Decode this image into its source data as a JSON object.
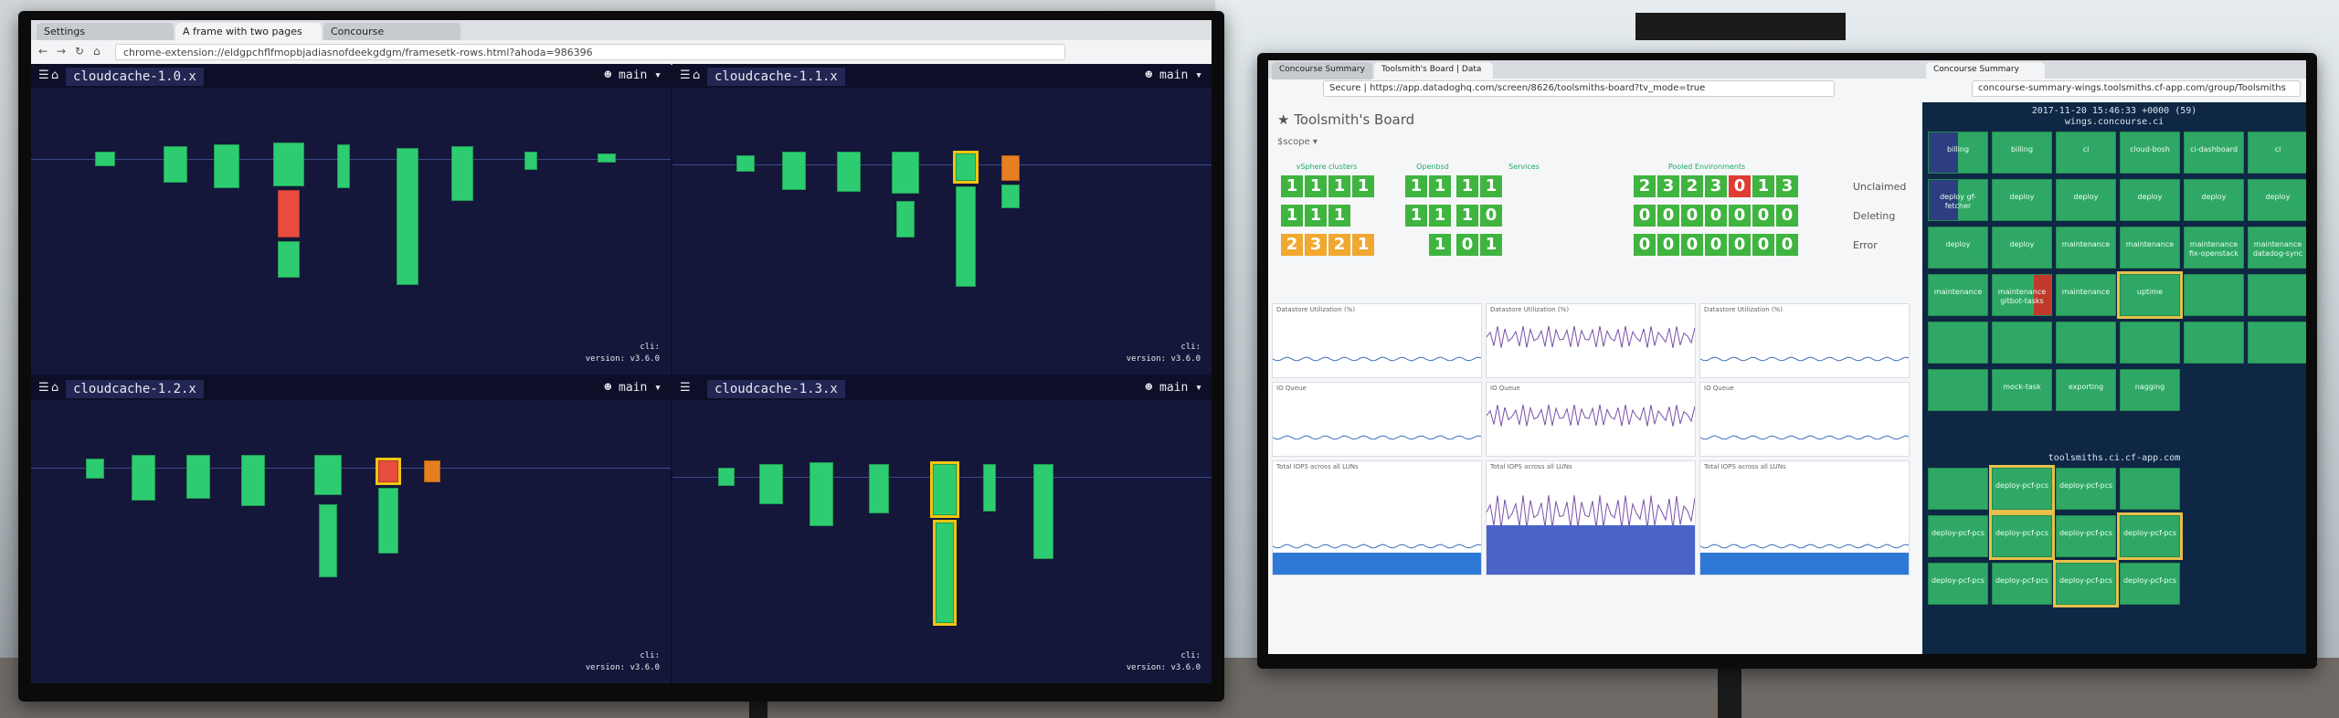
{
  "left_monitor": {
    "tabs": [
      "Settings",
      "A frame with two pages",
      "Concourse"
    ],
    "url": "chrome-extension://eldgpchflfmopbjadiasnofdeekgdgm/framesetk-rows.html?ahoda=986396",
    "quadrants": [
      {
        "name": "cloudcache-1.0.x",
        "branch": "main",
        "cli": "cli:",
        "version": "version: v3.6.0"
      },
      {
        "name": "cloudcache-1.1.x",
        "branch": "main",
        "cli": "cli:",
        "version": "version: v3.6.0"
      },
      {
        "name": "cloudcache-1.2.x",
        "branch": "main",
        "cli": "cli:",
        "version": "version: v3.6.0"
      },
      {
        "name": "cloudcache-1.3.x",
        "branch": "main",
        "cli": "cli:",
        "version": "version: v3.6.0"
      }
    ]
  },
  "right_monitor": {
    "tabs": [
      "Concourse Summary",
      "Toolsmith's Board | Data",
      "Concourse Summary"
    ],
    "url_left": "Secure | https://app.datadoghq.com/screen/8626/toolsmiths-board?tv_mode=true",
    "url_right": "concourse-summary-wings.toolsmiths.cf-app.com/group/Toolsmiths",
    "board_title": "Toolsmith's Board",
    "scope_label": "$scope",
    "sections": [
      "vSphere clusters",
      "Openbsd",
      "Services",
      "Pooled Environments"
    ],
    "row_labels": [
      "Unclaimed",
      "Deleting",
      "Error"
    ],
    "grid_rows": [
      [
        "1",
        "1",
        "1",
        "1",
        "",
        "1",
        "1",
        "1",
        "1",
        "2",
        "3",
        "2",
        "3",
        "0",
        "1",
        "3"
      ],
      [
        "1",
        "1",
        "1",
        "",
        "",
        "1",
        "1",
        "1",
        "0",
        "0",
        "0",
        "0",
        "0",
        "0",
        "0",
        "0"
      ],
      [
        "2",
        "3",
        "2",
        "1",
        "",
        "",
        "1",
        "0",
        "1",
        "0",
        "0",
        "0",
        "0",
        "0",
        "0",
        "0"
      ]
    ],
    "graph_titles": [
      "Datastore Utilization (%)",
      "Datastore Utilization (%)",
      "Datastore Utilization (%)",
      "IO Queue",
      "IO Queue",
      "IO Queue",
      "Total IOPS across all LUNs",
      "Total IOPS across all LUNs",
      "Total IOPS across all LUNs"
    ],
    "summary_time": "2017-11-20 15:46:33 +0000 (59)",
    "group1_host": "wings.concourse.ci",
    "group1_tiles": [
      "billing",
      "billing",
      "ci",
      "cloud-bosh",
      "ci-dashboard",
      "ci",
      "deploy gf-fetcher",
      "deploy",
      "deploy",
      "deploy",
      "deploy",
      "deploy",
      "deploy",
      "deploy",
      "maintenance",
      "maintenance",
      "maintenance fix-openstack",
      "maintenance datadog-sync",
      "maintenance",
      "maintenance gitbot-tasks",
      "maintenance",
      "uptime",
      "",
      "",
      "",
      "",
      "",
      "",
      "",
      "",
      "",
      "mock-task",
      "exporting",
      "nagging"
    ],
    "group2_host": "toolsmiths.ci.cf-app.com",
    "group2_tiles": [
      "",
      "deploy-pcf-pcs",
      "deploy-pcf-pcs",
      "",
      "deploy-pcf-pcs",
      "deploy-pcf-pcs",
      "deploy-pcf-pcs",
      "deploy-pcf-pcs",
      "deploy-pcf-pcs",
      "deploy-pcf-pcs",
      "deploy-pcf-pcs",
      "deploy-pcf-pcs"
    ]
  }
}
